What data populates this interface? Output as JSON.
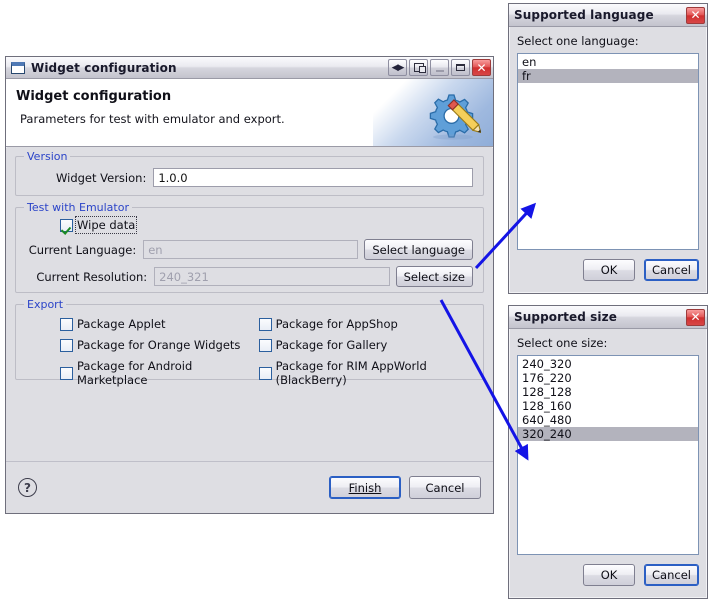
{
  "main_window": {
    "title": "Widget configuration",
    "icon": "window-icon",
    "titlebar_buttons": [
      {
        "name": "restore-arrows-button",
        "glyph": "◀▶"
      },
      {
        "name": "detach-button",
        "glyph": "detach"
      },
      {
        "name": "minimize-button",
        "glyph": "_"
      },
      {
        "name": "maximize-button",
        "glyph": "□"
      },
      {
        "name": "close-button",
        "glyph": "✕"
      }
    ],
    "banner": {
      "title": "Widget configuration",
      "subtitle": "Parameters for test with emulator and export.",
      "icon": "gear-pencil-icon"
    },
    "groups": {
      "version": {
        "legend": "Version",
        "field_label": "Widget Version:",
        "field_value": "1.0.0"
      },
      "emulator": {
        "legend": "Test with Emulator",
        "wipe_data_label": "Wipe data",
        "wipe_data_checked": true,
        "language_label": "Current Language:",
        "language_value": "en",
        "language_button": "Select language",
        "resolution_label": "Current Resolution:",
        "resolution_value": "240_321",
        "resolution_button": "Select size"
      },
      "export": {
        "legend": "Export",
        "checkboxes_left": [
          {
            "label": "Package Applet",
            "checked": false
          },
          {
            "label": "Package for Orange Widgets",
            "checked": false
          },
          {
            "label": "Package for Android Marketplace",
            "checked": false
          }
        ],
        "checkboxes_right": [
          {
            "label": "Package for AppShop",
            "checked": false
          },
          {
            "label": "Package for Gallery",
            "checked": false
          },
          {
            "label": "Package for RIM AppWorld (BlackBerry)",
            "checked": false
          }
        ]
      }
    },
    "footer": {
      "help_glyph": "?",
      "finish_label": "Finish",
      "cancel_label": "Cancel"
    }
  },
  "language_dialog": {
    "title": "Supported language",
    "close_glyph": "✕",
    "prompt": "Select one language:",
    "items": [
      {
        "label": "en",
        "selected": false
      },
      {
        "label": "fr",
        "selected": true
      }
    ],
    "ok_label": "OK",
    "cancel_label": "Cancel",
    "focused_button": "cancel"
  },
  "size_dialog": {
    "title": "Supported size",
    "close_glyph": "✕",
    "prompt": "Select one size:",
    "items": [
      {
        "label": "240_320",
        "selected": false
      },
      {
        "label": "176_220",
        "selected": false
      },
      {
        "label": "128_128",
        "selected": false
      },
      {
        "label": "128_160",
        "selected": false
      },
      {
        "label": "640_480",
        "selected": false
      },
      {
        "label": "320_240",
        "selected": true
      }
    ],
    "ok_label": "OK",
    "cancel_label": "Cancel",
    "focused_button": "cancel"
  },
  "annotations": {
    "arrow_color": "#1414e6",
    "arrows": [
      {
        "name": "arrow-select-language-to-language-dialog",
        "from": [
          476,
          268
        ],
        "to": [
          536,
          203
        ]
      },
      {
        "name": "arrow-select-size-to-size-dialog",
        "from": [
          440,
          300
        ],
        "to": [
          528,
          460
        ]
      }
    ]
  },
  "colors": {
    "dialog_background": "#dedee3",
    "group_legend": "#2b44c8",
    "selection": "#b3b3bd",
    "accent_blue": "#2b5fc4"
  }
}
